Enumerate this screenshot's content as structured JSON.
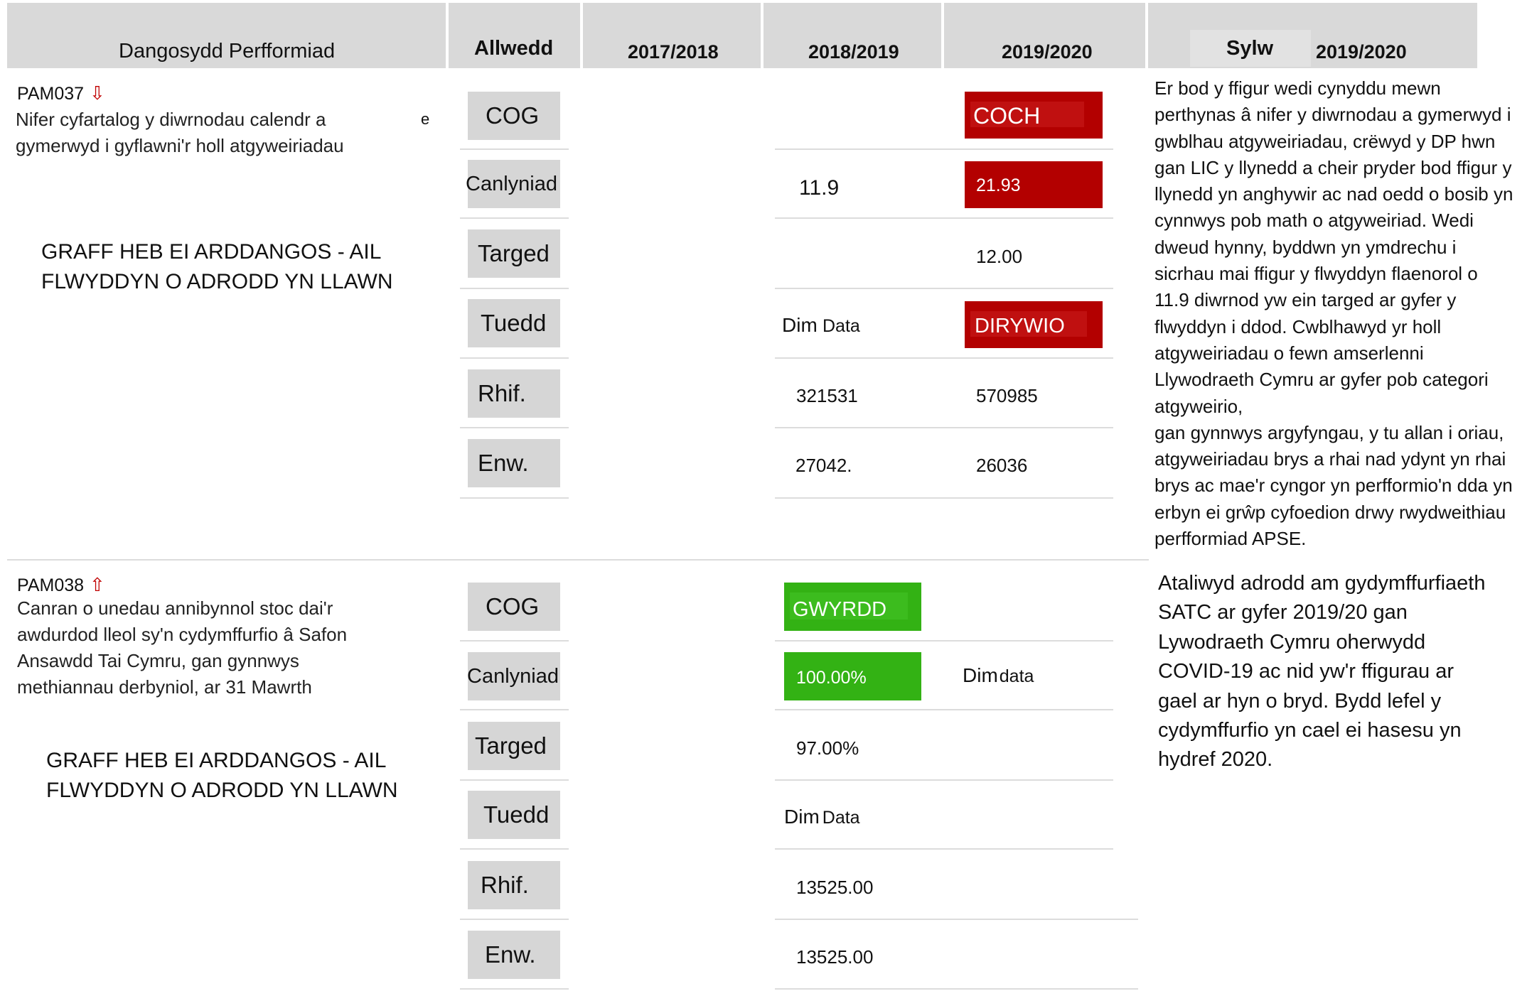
{
  "header": {
    "col_indicator": "Dangosydd Perfformiad",
    "col_key": "Allwedd",
    "col_2017": "2017/2018",
    "col_2018": "2018/2019",
    "col_2019": "2019/2020",
    "col_comment": "Sylw",
    "col_comment_year": "2019/2020"
  },
  "indicators": [
    {
      "code": "PAM037",
      "trend_arrow": "⇩",
      "description_lines": [
        "Nifer cyfartalog y diwrnodau calendr a",
        "gymerwyd i gyflawni'r holl atgyweiriadau"
      ],
      "stray_char": "e",
      "graph_note_lines": [
        "GRAFF HEB EI ARDDANGOS - AIL",
        "FLWYDDYN O ADRODD YN LLAWN"
      ],
      "keys": [
        "COG",
        "Canlyniad",
        "Targed",
        "Tuedd",
        "Rhif.",
        "Enw."
      ],
      "y2018": {
        "result": "11.9",
        "trend_a": "Dim",
        "trend_b": "Data",
        "num": "321531",
        "den": "27042."
      },
      "y2019": {
        "cog": "COCH",
        "result": "21.93",
        "target": "12.00",
        "trend": "DIRYWIO",
        "num": "570985",
        "den": "26036"
      },
      "comment_lines": [
        "Er bod y ffigur wedi cynyddu mewn",
        "perthynas â nifer y diwrnodau a gymerwyd i",
        "gwblhau atgyweiriadau, crëwyd y DP hwn",
        "gan LIC y llynedd a cheir pryder bod ffigur y",
        "llynedd yn anghywir ac nad oedd o bosib yn",
        "cynnwys pob math o atgyweiriad. Wedi",
        "dweud hynny, byddwn yn ymdrechu i",
        "sicrhau mai ffigur y flwyddyn flaenorol o",
        "11.9 diwrnod yw ein targed ar gyfer y",
        "flwyddyn i ddod. Cwblhawyd yr holl",
        "atgyweiriadau o fewn amserlenni",
        "Llywodraeth Cymru ar gyfer pob categori",
        "atgyweirio,",
        "gan gynnwys argyfyngau, y tu allan i oriau,",
        "atgyweiriadau brys a rhai nad ydynt yn rhai",
        "brys ac mae'r cyngor yn perfformio'n dda yn",
        "erbyn ei grŵp cyfoedion drwy rwydweithiau",
        "perfformiad APSE."
      ]
    },
    {
      "code": "PAM038",
      "trend_arrow": "⇧",
      "description_lines": [
        "Canran o unedau annibynnol stoc dai'r",
        "awdurdod lleol sy'n cydymffurfio â Safon",
        "Ansawdd Tai Cymru, gan gynnwys",
        "methiannau derbyniol, ar 31 Mawrth"
      ],
      "graph_note_lines": [
        "GRAFF HEB EI ARDDANGOS - AIL",
        "FLWYDDYN O ADRODD YN LLAWN"
      ],
      "keys": [
        "COG",
        "Canlyniad",
        "Targed",
        "Tuedd",
        "Rhif.",
        "Enw."
      ],
      "y2018": {
        "cog": "GWYRDD",
        "result": "100.00%",
        "target": "97.00%",
        "trend_a": "Dim",
        "trend_b": "Data",
        "num": "13525.00",
        "den": "13525.00"
      },
      "y2019": {
        "result_a": "Dim",
        "result_b": "data"
      },
      "comment_lines": [
        "Ataliwyd adrodd am gydymffurfiaeth",
        "SATC ar gyfer 2019/20 gan",
        "Lywodraeth Cymru oherwydd",
        "COVID-19 ac nid yw'r ffigurau ar",
        "gael ar hyn o bryd. Bydd lefel y",
        "cydymffurfio yn cael ei hasesu yn",
        "hydref 2020."
      ]
    }
  ],
  "colors": {
    "red": "#b30000",
    "green": "#33b214",
    "header_grey": "#d9d9d9",
    "key_grey": "#d6d6d6",
    "arrow": "#c00000"
  }
}
